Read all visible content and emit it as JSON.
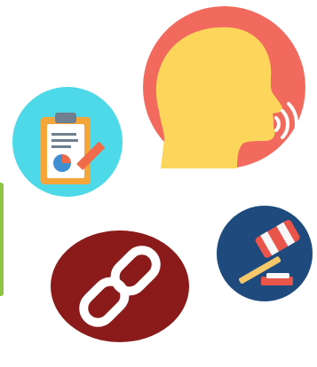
{
  "colors": {
    "background": "#ffffff",
    "edge_strip": "#8cc63f",
    "speaking_circle": "#f26a5e",
    "speaking_head": "#fcd65a",
    "speaking_waves": "#ffffff",
    "report_circle": "#4dd9e8",
    "report_board": "#f4a63a",
    "report_paper": "#ffffff",
    "report_lines": "#6f7f90",
    "report_pie_main": "#3e8fd1",
    "report_pie_slice": "#ef6b4a",
    "report_pencil": "#ef6b4a",
    "gavel_circle": "#1e4a7e",
    "gavel_head": "#e9554b",
    "gavel_band": "#f7f7f7",
    "gavel_handle": "#f4c86b",
    "gavel_block": "#e9554b",
    "link_circle": "#8b1a1a",
    "link_chain": "#ffffff"
  },
  "icons": [
    {
      "id": "speaking",
      "name": "speaking-head-icon"
    },
    {
      "id": "report",
      "name": "clipboard-report-icon"
    },
    {
      "id": "gavel",
      "name": "gavel-icon"
    },
    {
      "id": "link",
      "name": "chain-link-icon"
    }
  ]
}
